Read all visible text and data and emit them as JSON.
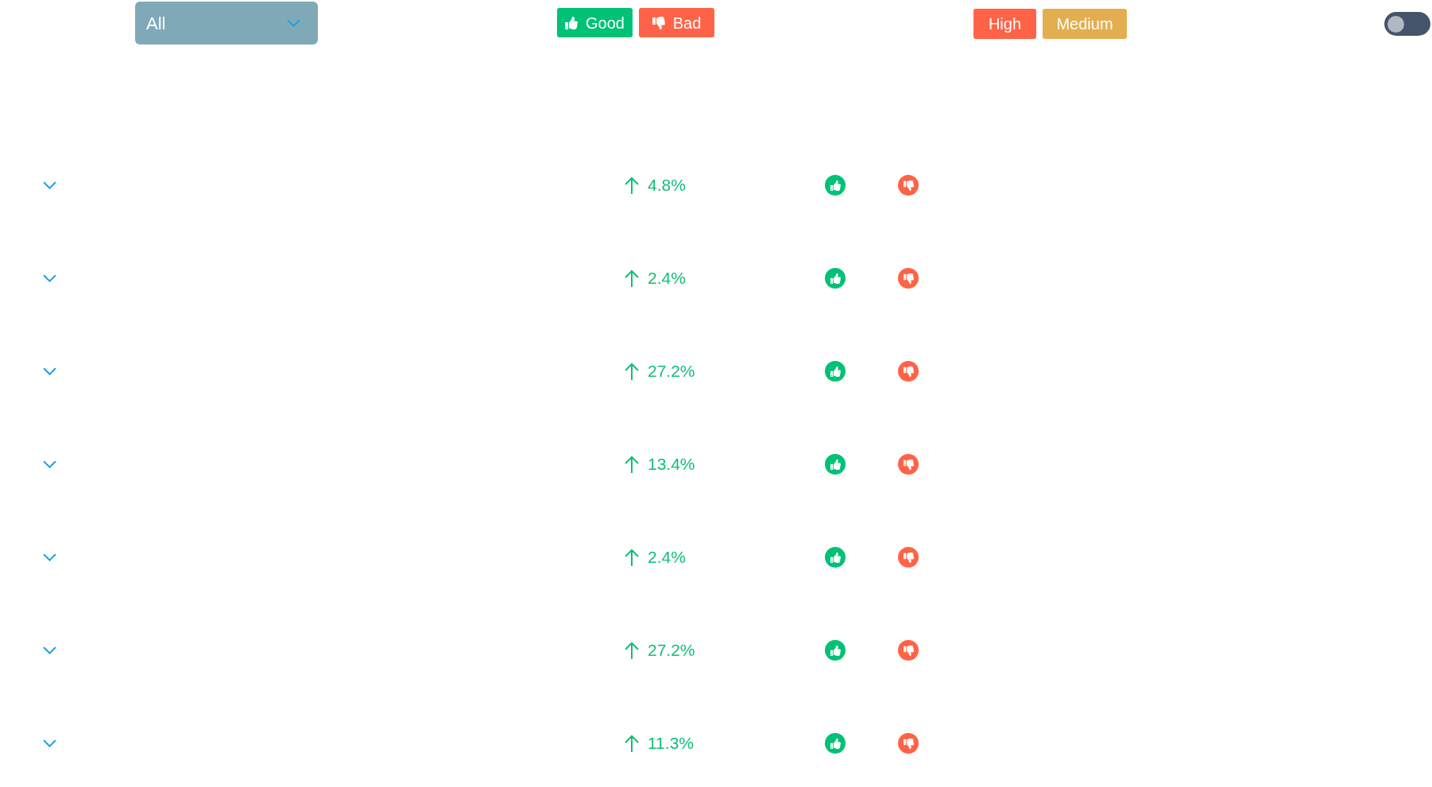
{
  "filter": {
    "value": "All",
    "expanded": false
  },
  "sentiment_buttons": [
    {
      "kind": "good",
      "label": "Good"
    },
    {
      "kind": "bad",
      "label": "Bad"
    }
  ],
  "priority_buttons": [
    {
      "kind": "high",
      "label": "High"
    },
    {
      "kind": "medium",
      "label": "Medium"
    }
  ],
  "toggle": {
    "on": false
  },
  "rows": [
    {
      "expanded": false,
      "kind": "up",
      "change": "4.8%"
    },
    {
      "expanded": false,
      "kind": "up",
      "change": "2.4%"
    },
    {
      "expanded": false,
      "kind": "up",
      "change": "27.2%"
    },
    {
      "expanded": false,
      "kind": "up",
      "change": "13.4%"
    },
    {
      "expanded": false,
      "kind": "up",
      "change": "2.4%"
    },
    {
      "expanded": false,
      "kind": "up",
      "change": "27.2%"
    },
    {
      "expanded": false,
      "kind": "up",
      "change": "11.3%"
    }
  ]
}
